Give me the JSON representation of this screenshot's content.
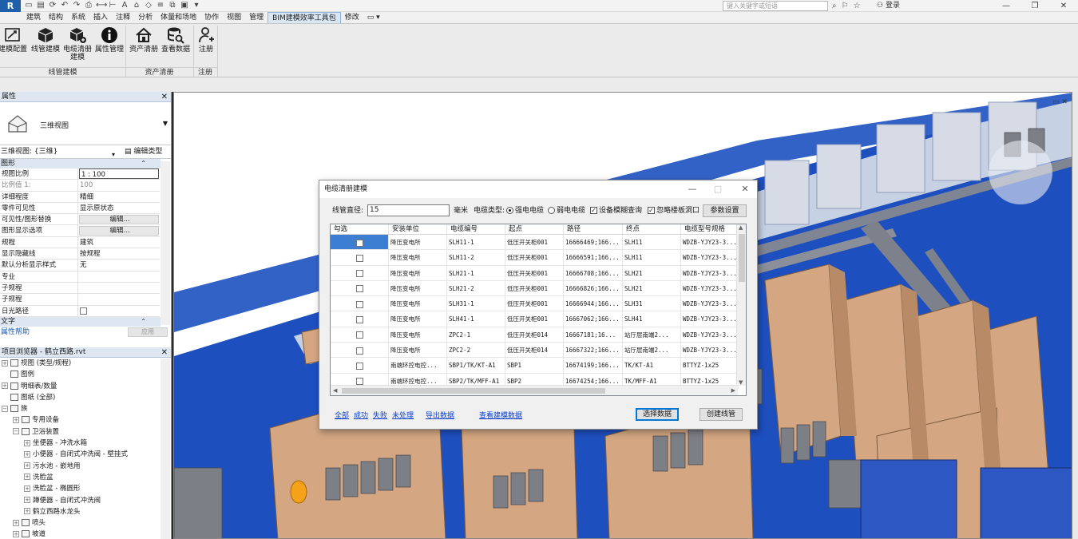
{
  "titlebar": {
    "search_placeholder": "键入关键字或短语",
    "login": "登录"
  },
  "ribbon_tabs": [
    "建筑",
    "结构",
    "系统",
    "插入",
    "注释",
    "分析",
    "体量和场地",
    "协作",
    "视图",
    "管理",
    "BIM建模效率工具包",
    "修改"
  ],
  "active_tab": "BIM建模效率工具包",
  "ribbon_buttons": [
    {
      "label": "建模配置",
      "icon": "settings-box-icon"
    },
    {
      "label": "线管建模",
      "icon": "cube-icon"
    },
    {
      "label": "电缆清册建模",
      "icon": "cube-add-icon"
    },
    {
      "label": "属性管理",
      "icon": "info-icon"
    },
    {
      "label": "资产清册",
      "icon": "home-icon"
    },
    {
      "label": "查看数据",
      "icon": "database-search-icon"
    },
    {
      "label": "注册",
      "icon": "user-icon"
    }
  ],
  "ribbon_panels": [
    "线管建模",
    "资产清册",
    "注册"
  ],
  "properties": {
    "title": "属性",
    "type_name": "三维视图",
    "view_selector": "三维视图: {三维}",
    "edit_type": "编辑类型",
    "section_graphics": "图形",
    "section_text": "文字",
    "rows": [
      {
        "key": "视图比例",
        "value": "1 : 100"
      },
      {
        "key": "比例值 1:",
        "value": "100"
      },
      {
        "key": "详细程度",
        "value": "精细"
      },
      {
        "key": "零件可见性",
        "value": "显示原状态"
      },
      {
        "key": "可见性/图形替换",
        "value": "编辑..."
      },
      {
        "key": "图形显示选项",
        "value": "编辑..."
      },
      {
        "key": "规程",
        "value": "建筑"
      },
      {
        "key": "显示隐藏线",
        "value": "按规程"
      },
      {
        "key": "默认分析显示样式",
        "value": "无"
      },
      {
        "key": "专业",
        "value": ""
      },
      {
        "key": "子规程",
        "value": ""
      },
      {
        "key": "子规程",
        "value": ""
      },
      {
        "key": "日光路径",
        "value": ""
      }
    ],
    "help_link": "属性帮助",
    "apply": "应用"
  },
  "browser": {
    "title": "项目浏览器 - 鹤立西路.rvt",
    "items": [
      {
        "label": "视图 (类型/规程)",
        "level": 0,
        "expander": "+"
      },
      {
        "label": "图例",
        "level": 0,
        "expander": ""
      },
      {
        "label": "明细表/数量",
        "level": 0,
        "expander": "+"
      },
      {
        "label": "图纸 (全部)",
        "level": 0,
        "expander": ""
      },
      {
        "label": "族",
        "level": 0,
        "expander": "−"
      },
      {
        "label": "专用设备",
        "level": 1,
        "expander": "+"
      },
      {
        "label": "卫浴装置",
        "level": 1,
        "expander": "−"
      },
      {
        "label": "坐便器 - 冲洗水箱",
        "level": 2,
        "expander": "+"
      },
      {
        "label": "小便器 - 自闭式冲洗阀 - 壁挂式",
        "level": 2,
        "expander": "+"
      },
      {
        "label": "污水池 - 嵌地用",
        "level": 2,
        "expander": "+"
      },
      {
        "label": "洗脸盆",
        "level": 2,
        "expander": "+"
      },
      {
        "label": "洗脸盆 - 椭圆形",
        "level": 2,
        "expander": "+"
      },
      {
        "label": "蹲便器 - 自闭式冲洗阀",
        "level": 2,
        "expander": "+"
      },
      {
        "label": "鹤立西路水龙头",
        "level": 2,
        "expander": "+"
      },
      {
        "label": "喷头",
        "level": 1,
        "expander": "+"
      },
      {
        "label": "坡道",
        "level": 1,
        "expander": "+"
      }
    ]
  },
  "dialog": {
    "title": "电缆清册建模",
    "diameter_label": "线管直径:",
    "diameter_value": "15",
    "unit": "毫米",
    "cable_type_label": "电缆类型:",
    "radio_strong": "强电电缆",
    "radio_weak": "弱电电缆",
    "chk_bridge": "设备模糊查询",
    "chk_ignore": "忽略楼板洞口",
    "btn_params": "参数设置",
    "columns": [
      "勾选",
      "安装单位",
      "电缆编号",
      "起点",
      "路径",
      "终点",
      "电缆型号规格"
    ],
    "rows": [
      [
        "",
        "降压变电所",
        "SLH11-1",
        "低压开关柜001",
        "16666469;166...",
        "SLH11",
        "WDZB-YJY23-3..."
      ],
      [
        "",
        "降压变电所",
        "SLH11-2",
        "低压开关柜001",
        "16666591;166...",
        "SLH11",
        "WDZB-YJY23-3..."
      ],
      [
        "",
        "降压变电所",
        "SLH21-1",
        "低压开关柜001",
        "16666708;166...",
        "SLH21",
        "WDZB-YJY23-3..."
      ],
      [
        "",
        "降压变电所",
        "SLH21-2",
        "低压开关柜001",
        "16666826;166...",
        "SLH21",
        "WDZB-YJY23-3..."
      ],
      [
        "",
        "降压变电所",
        "SLH31-1",
        "低压开关柜001",
        "16666944;166...",
        "SLH31",
        "WDZB-YJY23-3..."
      ],
      [
        "",
        "降压变电所",
        "SLH41-1",
        "低压开关柜001",
        "16667062;166...",
        "SLH41",
        "WDZB-YJY23-3..."
      ],
      [
        "",
        "降压变电所",
        "ZPC2-1",
        "低压开关柜014",
        "16667181;16...",
        "站厅层南端2...",
        "WDZB-YJY23-3..."
      ],
      [
        "",
        "降压变电所",
        "ZPC2-2",
        "低压开关柜014",
        "16667322;166...",
        "站厅层南端2...",
        "WDZB-YJY23-3..."
      ],
      [
        "",
        "南端环控电控...",
        "SBP1/TK/KT-A1",
        "SBP1",
        "16674199;166...",
        "TK/KT-A1",
        "BTTYZ-1x25"
      ],
      [
        "",
        "南端环控电控...",
        "SBP2/TK/MFF-A1",
        "SBP2",
        "16674254;166...",
        "TK/MFF-A1",
        "BTTYZ-1x25"
      ]
    ],
    "filters": [
      "全部",
      "成功",
      "失败",
      "未处理"
    ],
    "export": "导出数据",
    "view_data": "查看建模数据",
    "btn_select": "选择数据",
    "btn_create": "创建线管"
  }
}
